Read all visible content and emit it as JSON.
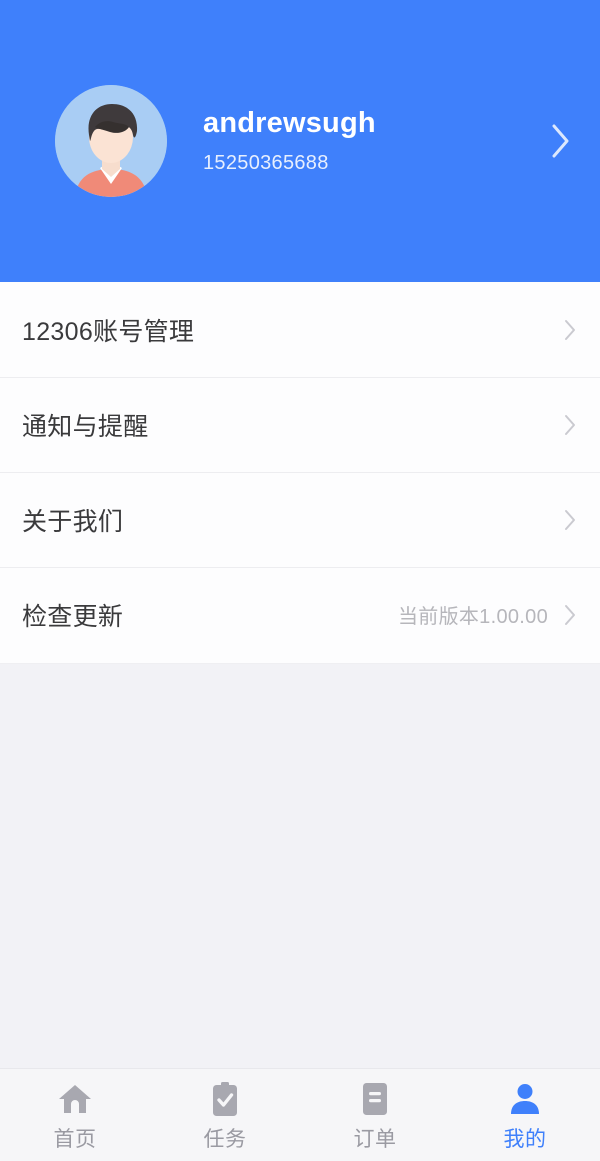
{
  "theme": {
    "header_blue": "#3F80FB",
    "accent_blue": "#3F80FB",
    "page_bg": "#F2F2F6",
    "card_bg": "#FDFDFE",
    "muted_text": "#B6B6BB",
    "primary_text": "#3A3A3C",
    "tab_inactive": "#9A9AA2"
  },
  "header": {
    "avatar_icon": "user-avatar-illustration",
    "username": "andrewsugh",
    "phone": "15250365688",
    "chevron_icon": "chevron-right-icon"
  },
  "menu": {
    "items": [
      {
        "label": "12306账号管理",
        "value": "",
        "chevron_icon": "chevron-right-icon",
        "name": "menu-item-12306-account"
      },
      {
        "label": "通知与提醒",
        "value": "",
        "chevron_icon": "chevron-right-icon",
        "name": "menu-item-notifications"
      },
      {
        "label": "关于我们",
        "value": "",
        "chevron_icon": "chevron-right-icon",
        "name": "menu-item-about-us"
      },
      {
        "label": "检查更新",
        "value": "当前版本1.00.00",
        "chevron_icon": "chevron-right-icon",
        "name": "menu-item-check-update"
      }
    ]
  },
  "tabbar": {
    "tabs": [
      {
        "label": "首页",
        "icon": "home-icon",
        "active": false,
        "name": "tab-home"
      },
      {
        "label": "任务",
        "icon": "clipboard-check-icon",
        "active": false,
        "name": "tab-task"
      },
      {
        "label": "订单",
        "icon": "order-list-icon",
        "active": false,
        "name": "tab-order"
      },
      {
        "label": "我的",
        "icon": "person-icon",
        "active": true,
        "name": "tab-profile"
      }
    ]
  }
}
